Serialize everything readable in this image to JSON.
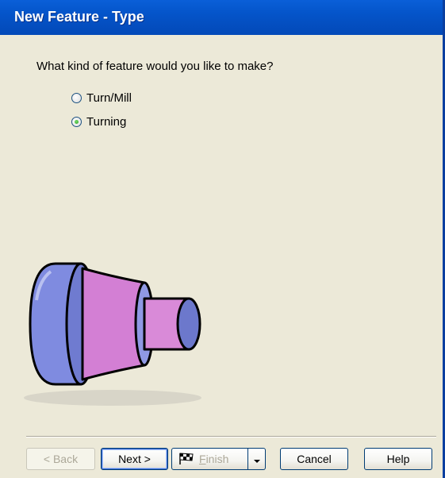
{
  "window": {
    "title": "New Feature - Type"
  },
  "prompt": {
    "question": "What kind of feature would you like to make?"
  },
  "options": [
    {
      "label": "Turn/Mill",
      "selected": false
    },
    {
      "label": "Turning",
      "selected": true
    }
  ],
  "illustration": {
    "icon": "turned-part-illustration"
  },
  "buttons": {
    "back": {
      "label": "< Back",
      "enabled": false
    },
    "next": {
      "label": "Next >",
      "enabled": true,
      "default": true
    },
    "finish": {
      "label_first": "F",
      "label_rest": "inish",
      "enabled": false,
      "icon": "checkered-flag-icon"
    },
    "cancel": {
      "label": "Cancel",
      "enabled": true
    },
    "help": {
      "label": "Help",
      "enabled": true
    }
  },
  "colors": {
    "titlebar": "#0454c9",
    "body": "#ece9d8",
    "part_blue": "#7a86d8",
    "part_pink": "#d46fd0"
  }
}
